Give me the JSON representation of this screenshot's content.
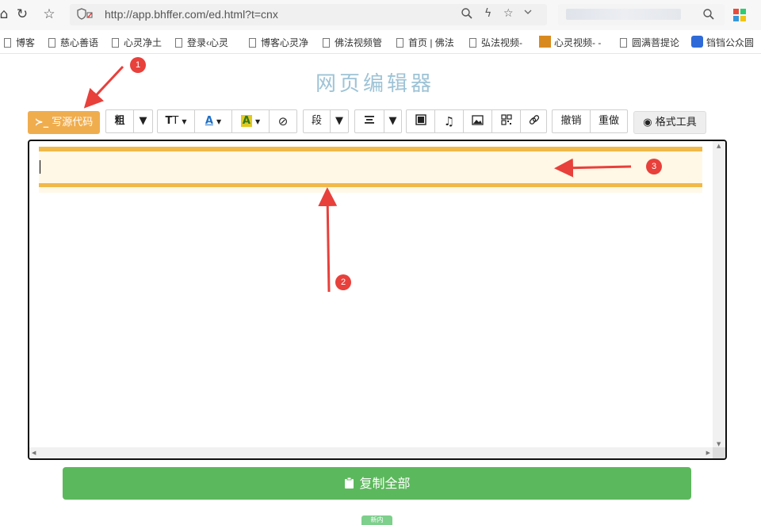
{
  "browser": {
    "url": "http://app.bhffer.com/ed.html?t=cnx",
    "bookmarks": [
      "博客",
      "慈心善语",
      "心灵净土",
      "登录‹心灵",
      "博客心灵净",
      "佛法视频管",
      "首页 | 佛法",
      "弘法视频-",
      "心灵视频- -",
      "圆满菩提论",
      "铛铛公众圆"
    ]
  },
  "page": {
    "title": "网页编辑器"
  },
  "toolbar": {
    "source_code": "写源代码",
    "bold": "粗",
    "font_size_icon": "font-size-icon",
    "font_color_icon": "font-color-icon",
    "bg_color_icon": "highlight-color-icon",
    "clear_icon": "clear-format-icon",
    "paragraph": "段",
    "align_icon": "align-icon",
    "video_icon": "video-icon",
    "music_icon": "music-icon",
    "image_icon": "image-icon",
    "qrcode_icon": "qrcode-icon",
    "link_icon": "link-icon",
    "undo": "撤销",
    "redo": "重做",
    "format_tools": "格式工具"
  },
  "copy_all": "复制全部",
  "bottom_tab": "新内",
  "annotations": [
    "1",
    "2",
    "3"
  ],
  "colors": {
    "source_btn": "#f0ad4e",
    "copy_btn": "#5cb85c",
    "highlight_bar": "#f0b94a",
    "highlight_fill": "#fff8e6",
    "title": "#9ec3d6",
    "annotation_red": "#e8403b"
  }
}
